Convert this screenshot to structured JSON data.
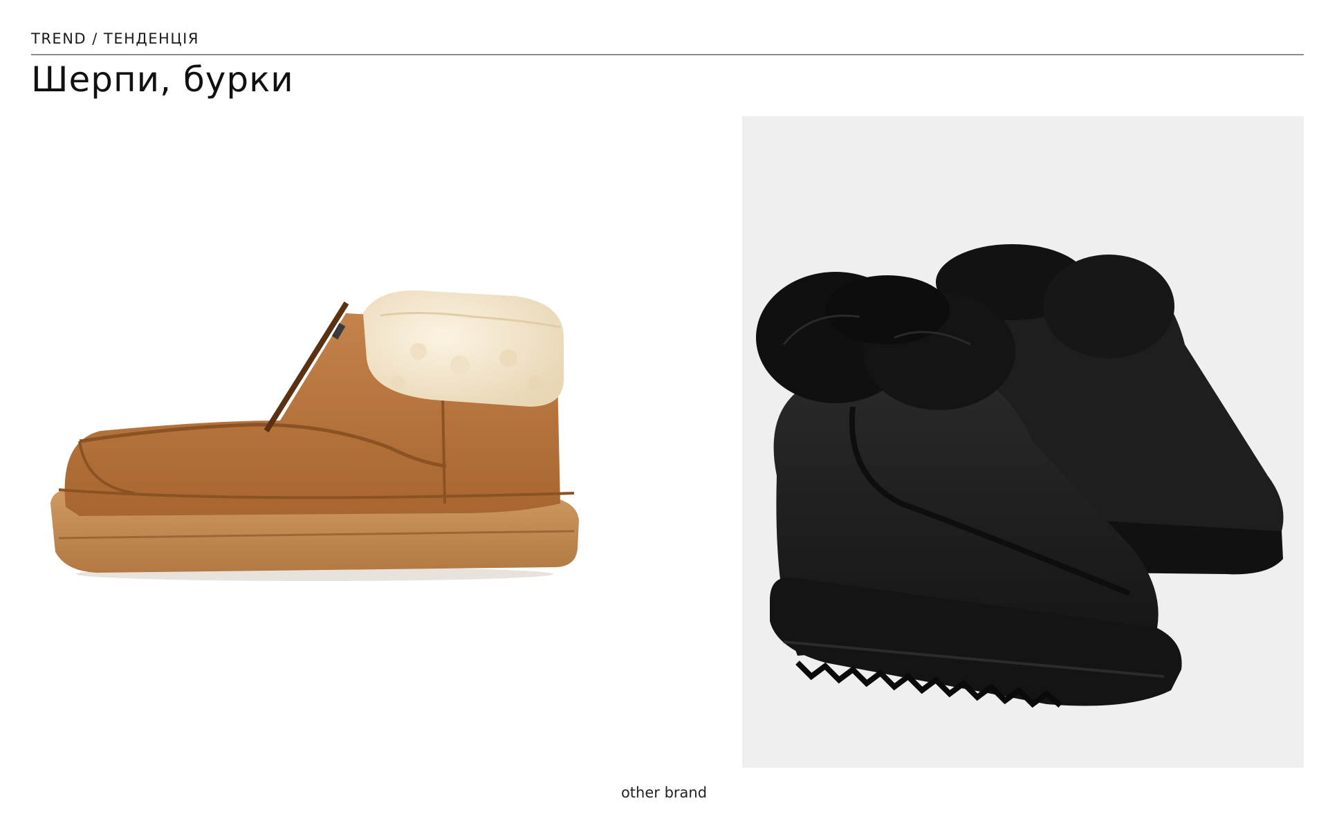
{
  "header": {
    "kicker": "TREND / ТЕНДЕНЦІЯ",
    "title": "Шерпи, бурки"
  },
  "images": [
    {
      "subject": "tan suede zip boot with cream sherpa cuff"
    },
    {
      "subject": "pair of black boots with black faux-fur cuffs on grey background"
    }
  ],
  "caption": "other brand",
  "colors": {
    "rule": "#8c8c8c",
    "right_photo_bg": "#efefef",
    "suede": "#b9773f",
    "sole": "#c58a52",
    "sherpa": "#f3e6cd",
    "black": "#1c1c1c"
  }
}
